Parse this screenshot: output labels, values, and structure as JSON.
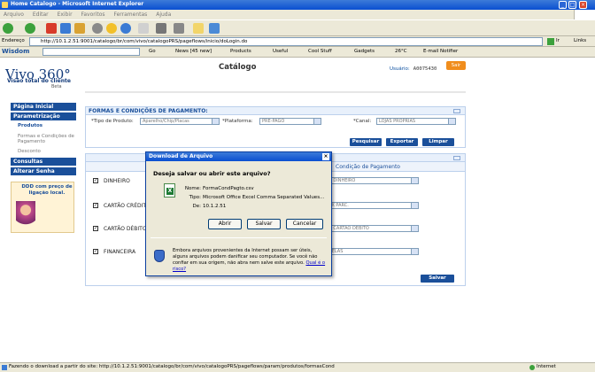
{
  "window": {
    "title": "Home Catalogo - Microsoft Internet Explorer"
  },
  "menu": [
    "Arquivo",
    "Editar",
    "Exibir",
    "Favoritos",
    "Ferramentas",
    "Ajuda"
  ],
  "addressbar": {
    "label": "Endereço",
    "url": "http://10.1.2.51:9001/catalogo/br/com/vivo/catalogoPRS/pageflows/inicio/doLogin.do",
    "go": "Ir",
    "links": "Links"
  },
  "wisdombar": {
    "brand": "Wisdom",
    "go": "Go",
    "news": "News [45 new]",
    "products": "Products",
    "useful": "Useful",
    "coolstuff": "Cool Stuff",
    "gadgets": "Gadgets",
    "temp": "26°C",
    "email": "E-mail Notifier"
  },
  "header": {
    "logo_main": "Vivo 360°",
    "logo_sub": "Visão total do cliente",
    "logo_beta": "Beta",
    "page_title": "Catálogo",
    "user_label": "Usuário:",
    "user_value": "A0075430",
    "logout": "Sair"
  },
  "sidebar": {
    "home": "Página Inicial",
    "param": "Parametrização",
    "items": [
      "Produtos",
      "Formas e Condições de Pagamento",
      "Desconto"
    ],
    "consultas": "Consultas",
    "senha": "Alterar Senha",
    "promo": "DDD com preço de ligação local."
  },
  "filter_panel": {
    "title": "FORMAS E CONDIÇÕES DE PAGAMENTO:",
    "tipo_label": "*Tipo de Produto:",
    "tipo_value": "Aparelho/Chip/Placas",
    "plataforma_label": "*Plataforma:",
    "plataforma_value": "PRÉ-PAGO",
    "canal_label": "*Canal:",
    "canal_value": "LOJAS PRÓPRIAS",
    "btn_search": "Pesquisar",
    "btn_export": "Exportar",
    "btn_clear": "Limpar"
  },
  "results_panel": {
    "col_condicao": "Condição de Pagamento",
    "rows": [
      {
        "label": "DINHEIRO",
        "condition": "A - DINHEIRO"
      },
      {
        "label": "CARTÃO CRÉDITO",
        "condition": "10X PARC."
      },
      {
        "label": "CARTÃO DÉBITO",
        "condition": "A - CARTÃO DÉBITO"
      },
      {
        "label": "FINANCEIRA",
        "condition": "RCELAS"
      }
    ],
    "save": "Salvar"
  },
  "dialog": {
    "title": "Download de Arquivo",
    "question": "Deseja salvar ou abrir este arquivo?",
    "name_label": "Nome:",
    "name_value": "FormaCondPagto.csv",
    "type_label": "Tipo:",
    "type_value": "Microsoft Office Excel Comma Separated Values...",
    "from_label": "De:",
    "from_value": "10.1.2.51",
    "btn_open": "Abrir",
    "btn_save": "Salvar",
    "btn_cancel": "Cancelar",
    "warning": "Embora arquivos provenientes da Internet possam ser úteis, alguns arquivos podem danificar seu computador. Se você não confiar em sua origem, não abra nem salve este arquivo.",
    "warning_link": "Qual é o risco?"
  },
  "status": {
    "text": "Fazendo o download a partir do site: http://10.1.2.51:9001/catalogo/br/com/vivo/catalogoPRS/pageflows/param/produtos/formasCond",
    "zone": "Internet"
  }
}
